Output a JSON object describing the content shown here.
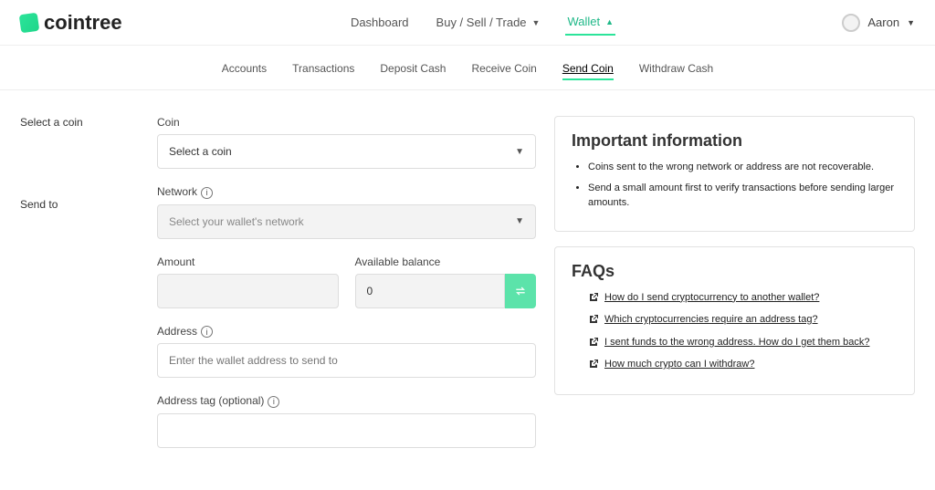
{
  "logo": "cointree",
  "nav": {
    "dashboard": "Dashboard",
    "trade": "Buy / Sell / Trade",
    "wallet": "Wallet"
  },
  "user": {
    "name": "Aaron"
  },
  "subnav": {
    "accounts": "Accounts",
    "transactions": "Transactions",
    "deposit": "Deposit Cash",
    "receive": "Receive Coin",
    "send": "Send Coin",
    "withdraw": "Withdraw Cash"
  },
  "labels": {
    "select_coin": "Select a coin",
    "coin": "Coin",
    "select_coin_placeholder": "Select a coin",
    "send_to": "Send to",
    "network": "Network",
    "network_placeholder": "Select your wallet's network",
    "amount": "Amount",
    "available": "Available balance",
    "available_value": "0",
    "address": "Address",
    "address_placeholder": "Enter the wallet address to send to",
    "address_tag": "Address tag (optional)"
  },
  "info": {
    "title": "Important information",
    "bullets": [
      "Coins sent to the wrong network or address are not recoverable.",
      "Send a small amount first to verify transactions before sending larger amounts."
    ]
  },
  "faqs": {
    "title": "FAQs",
    "items": [
      "How do I send cryptocurrency to another wallet?",
      "Which cryptocurrencies require an address tag?",
      "I sent funds to the wrong address. How do I get them back?",
      "How much crypto can I withdraw?"
    ]
  }
}
